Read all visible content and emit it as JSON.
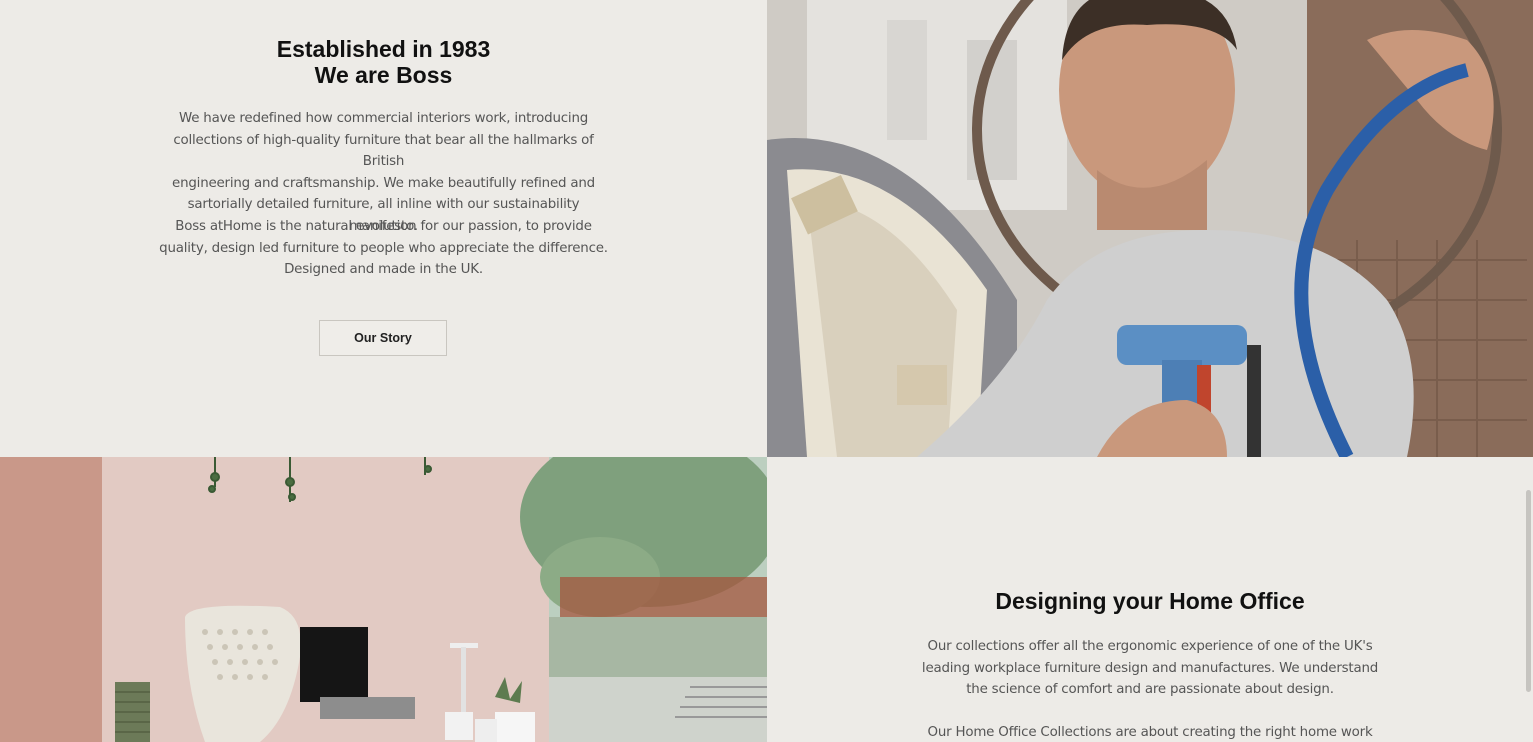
{
  "about": {
    "heading_line1": "Established in 1983",
    "heading_line2": "We are Boss",
    "paragraph1": [
      "We have redefined how commercial interiors work, introducing",
      "collections of high-quality furniture that bear all the hallmarks of British",
      "engineering and craftsmanship. We make beautifully refined and",
      "sartorially detailed furniture, all inline with our sustainability manifesto."
    ],
    "paragraph2": [
      "Boss atHome is the natural evolution for our passion, to provide",
      "quality, design led furniture to people who appreciate the difference.",
      "Designed and made in the UK."
    ],
    "button_label": "Our Story"
  },
  "home_office": {
    "heading": "Designing your Home Office",
    "paragraph1": [
      "Our collections offer all the ergonomic experience of one of the UK's",
      "leading workplace furniture design and manufactures. We understand",
      "the science of comfort and are passionate about design."
    ],
    "paragraph2": [
      "Our Home Office Collections are about creating the right home work"
    ]
  },
  "images": {
    "craftsman_photo": "craftsman-upholstery-photo",
    "home_office_photo": "home-office-desk-photo"
  },
  "colors": {
    "panel_bg": "#edebe7",
    "text": "#555555",
    "heading": "#111111"
  }
}
